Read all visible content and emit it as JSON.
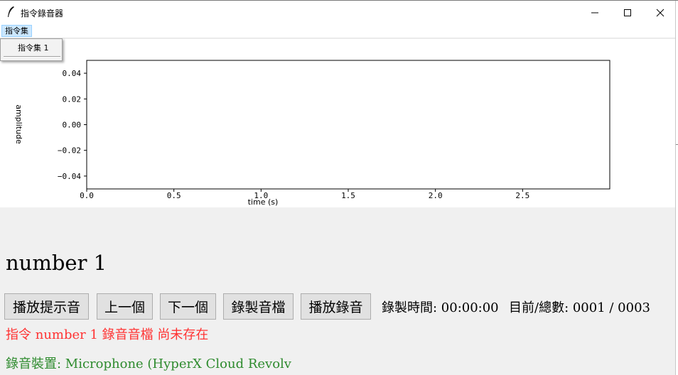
{
  "window": {
    "title": "指令錄音器"
  },
  "menubar": {
    "menu_label": "指令集"
  },
  "dropdown": {
    "items": [
      {
        "label": "指令集 1"
      }
    ]
  },
  "main": {
    "prompt_text": "number 1",
    "buttons": {
      "play_prompt": "播放提示音",
      "previous": "上一個",
      "next": "下一個",
      "record": "錄製音檔",
      "play_recording": "播放錄音"
    },
    "record_time_text": "錄製時間: 00:00:00",
    "progress_text": "目前/總數: 0001 / 0003",
    "status_message": "指令 number 1 錄音音檔 尚未存在",
    "device_text": "錄音裝置: Microphone (HyperX Cloud Revolv"
  },
  "colors": {
    "status_red": "#ff3333",
    "status_green": "#2e8b2e",
    "menu_highlight": "#cce8ff"
  },
  "chart_data": {
    "type": "line",
    "title": "",
    "xlabel": "time (s)",
    "ylabel": "amplitude",
    "xlim": [
      0,
      3
    ],
    "ylim": [
      -0.05,
      0.05
    ],
    "xticks": [
      "0.0",
      "0.5",
      "1.0",
      "1.5",
      "2.0",
      "2.5"
    ],
    "yticks": [
      "0.04",
      "0.02",
      "0.00",
      "−0.02",
      "−0.04"
    ],
    "series": [],
    "grid": false
  }
}
